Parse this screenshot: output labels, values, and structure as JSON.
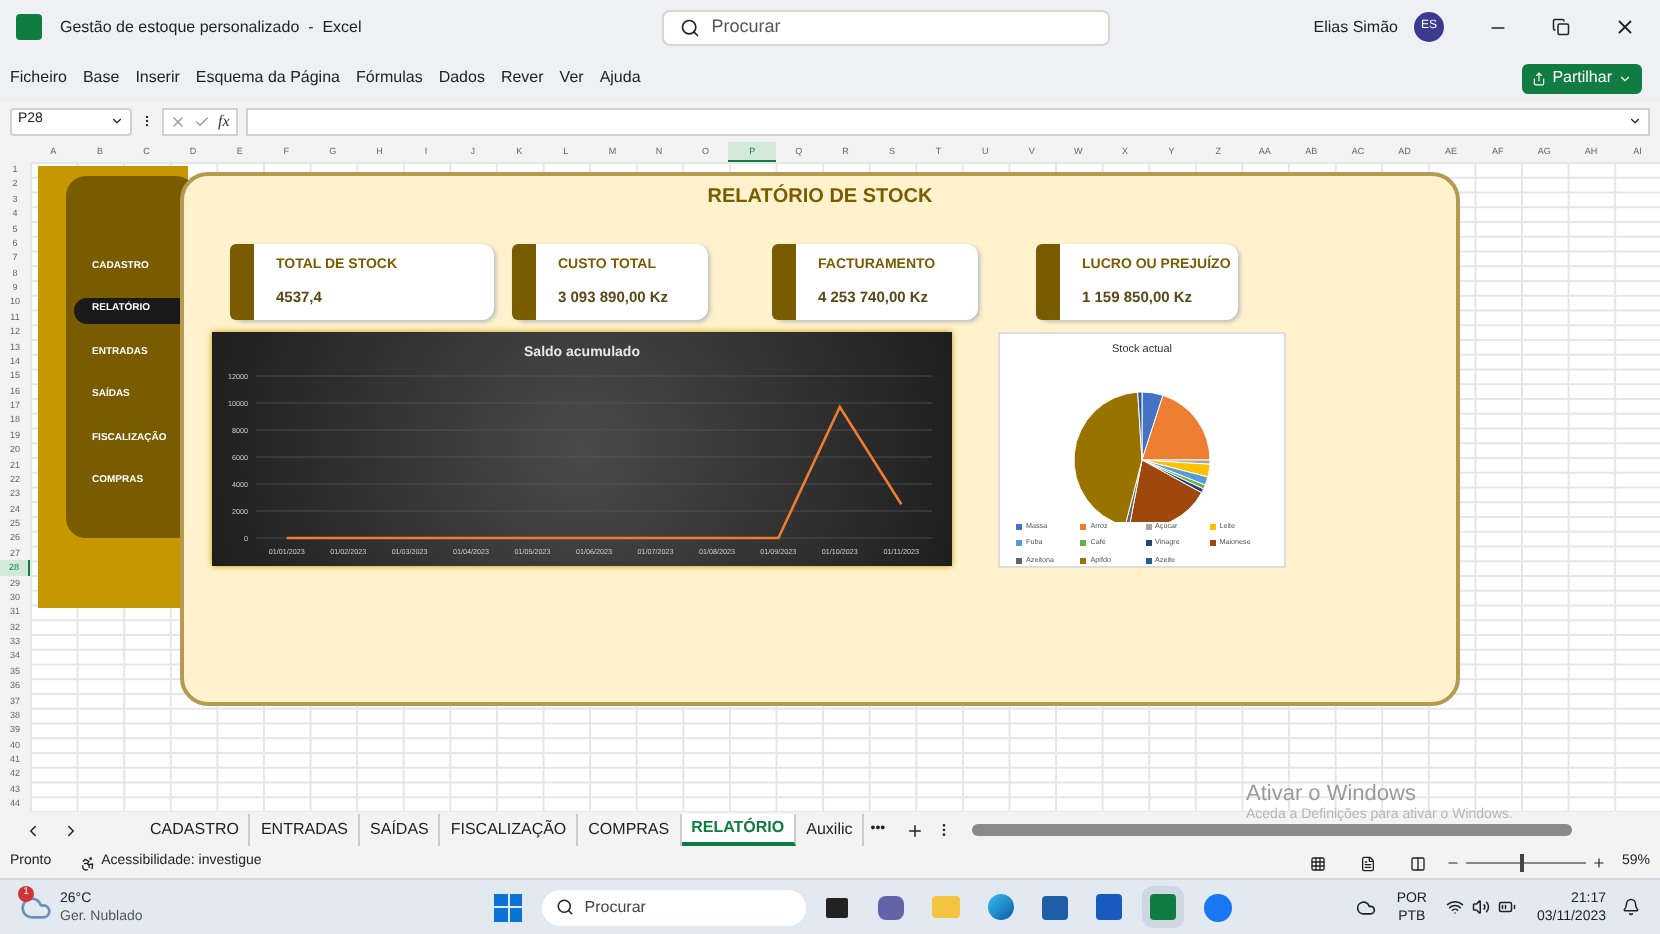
{
  "window": {
    "title": "Gestão de estoque personalizado  -  Excel",
    "search_placeholder": "Procurar",
    "user_name": "Elias Simão",
    "user_initials": "ES"
  },
  "ribbon_tabs": [
    "Ficheiro",
    "Base",
    "Inserir",
    "Esquema da Página",
    "Fórmulas",
    "Dados",
    "Rever",
    "Ver",
    "Ajuda"
  ],
  "share_button": "Partilhar",
  "formula_bar": {
    "name_box": "P28",
    "function_label": "fx"
  },
  "columns": [
    {
      "label": "A",
      "selected": false
    },
    {
      "label": "B",
      "selected": false
    },
    {
      "label": "C",
      "selected": false
    },
    {
      "label": "D",
      "selected": false
    },
    {
      "label": "E",
      "selected": false
    },
    {
      "label": "F",
      "selected": false
    },
    {
      "label": "G",
      "selected": false
    },
    {
      "label": "H",
      "selected": false
    },
    {
      "label": "I",
      "selected": false
    },
    {
      "label": "J",
      "selected": false
    },
    {
      "label": "K",
      "selected": false
    },
    {
      "label": "L",
      "selected": false
    },
    {
      "label": "M",
      "selected": false
    },
    {
      "label": "N",
      "selected": false
    },
    {
      "label": "O",
      "selected": false
    },
    {
      "label": "P",
      "selected": true
    },
    {
      "label": "Q",
      "selected": false
    },
    {
      "label": "R",
      "selected": false
    },
    {
      "label": "S",
      "selected": false
    },
    {
      "label": "T",
      "selected": false
    },
    {
      "label": "U",
      "selected": false
    },
    {
      "label": "V",
      "selected": false
    },
    {
      "label": "W",
      "selected": false
    },
    {
      "label": "X",
      "selected": false
    },
    {
      "label": "Y",
      "selected": false
    },
    {
      "label": "Z",
      "selected": false
    },
    {
      "label": "AA",
      "selected": false
    },
    {
      "label": "AB",
      "selected": false
    },
    {
      "label": "AC",
      "selected": false
    },
    {
      "label": "AD",
      "selected": false
    },
    {
      "label": "AE",
      "selected": false
    },
    {
      "label": "AF",
      "selected": false
    },
    {
      "label": "AG",
      "selected": false
    },
    {
      "label": "AH",
      "selected": false
    },
    {
      "label": "AI",
      "selected": false
    }
  ],
  "rows": [
    {
      "label": "1",
      "selected": false
    },
    {
      "label": "2",
      "selected": false
    },
    {
      "label": "3",
      "selected": false
    },
    {
      "label": "4",
      "selected": false
    },
    {
      "label": "5",
      "selected": false
    },
    {
      "label": "6",
      "selected": false
    },
    {
      "label": "7",
      "selected": false
    },
    {
      "label": "8",
      "selected": false
    },
    {
      "label": "9",
      "selected": false
    },
    {
      "label": "10",
      "selected": false
    },
    {
      "label": "11",
      "selected": false
    },
    {
      "label": "12",
      "selected": false
    },
    {
      "label": "13",
      "selected": false
    },
    {
      "label": "14",
      "selected": false
    },
    {
      "label": "15",
      "selected": false
    },
    {
      "label": "16",
      "selected": false
    },
    {
      "label": "17",
      "selected": false
    },
    {
      "label": "18",
      "selected": false
    },
    {
      "label": "19",
      "selected": false
    },
    {
      "label": "20",
      "selected": false
    },
    {
      "label": "21",
      "selected": false
    },
    {
      "label": "22",
      "selected": false
    },
    {
      "label": "23",
      "selected": false
    },
    {
      "label": "24",
      "selected": false
    },
    {
      "label": "25",
      "selected": false
    },
    {
      "label": "26",
      "selected": false
    },
    {
      "label": "27",
      "selected": false
    },
    {
      "label": "28",
      "selected": true
    },
    {
      "label": "29",
      "selected": false
    },
    {
      "label": "30",
      "selected": false
    },
    {
      "label": "31",
      "selected": false
    },
    {
      "label": "32",
      "selected": false
    },
    {
      "label": "33",
      "selected": false
    },
    {
      "label": "34",
      "selected": false
    },
    {
      "label": "35",
      "selected": false
    },
    {
      "label": "36",
      "selected": false
    },
    {
      "label": "37",
      "selected": false
    },
    {
      "label": "38",
      "selected": false
    },
    {
      "label": "39",
      "selected": false
    },
    {
      "label": "40",
      "selected": false
    },
    {
      "label": "41",
      "selected": false
    },
    {
      "label": "42",
      "selected": false
    },
    {
      "label": "43",
      "selected": false
    },
    {
      "label": "44",
      "selected": false
    }
  ],
  "dashboard": {
    "title": "RELATÓRIO DE STOCK",
    "nav_items": [
      {
        "label": "CADASTRO",
        "selected": false
      },
      {
        "label": "RELATÓRIO",
        "selected": true
      },
      {
        "label": "ENTRADAS",
        "selected": false
      },
      {
        "label": "SAÍDAS",
        "selected": false
      },
      {
        "label": "FISCALIZAÇÃO",
        "selected": false
      },
      {
        "label": "COMPRAS",
        "selected": false
      }
    ],
    "cards": [
      {
        "label": "TOTAL DE STOCK",
        "value": "4537,4"
      },
      {
        "label": "CUSTO TOTAL",
        "value": "3 093 890,00 Kz"
      },
      {
        "label": "FACTURAMENTO",
        "value": "4 253 740,00 Kz"
      },
      {
        "label": "LUCRO OU PREJUÍZO",
        "value": "1 159 850,00 Kz"
      }
    ],
    "line_chart": {
      "chart_data": {
        "type": "line",
        "title": "Saldo acumulado",
        "categories": [
          "01/01/2023",
          "01/02/2023",
          "01/03/2023",
          "01/04/2023",
          "01/05/2023",
          "01/06/2023",
          "01/07/2023",
          "01/08/2023",
          "01/09/2023",
          "01/10/2023",
          "01/11/2023"
        ],
        "series": [
          {
            "color": "#ed7d31",
            "values": [
              0,
              0,
              0,
              0,
              0,
              0,
              0,
              0,
              0,
              9700,
              2500
            ]
          }
        ],
        "grid": true,
        "ylim": [
          0,
          12000
        ],
        "yticks": [
          0,
          2000,
          4000,
          6000,
          8000,
          10000,
          12000
        ]
      }
    },
    "pie_chart": {
      "title": "Stock actual",
      "legend": [
        {
          "name": "Massa",
          "color": "#4472c4"
        },
        {
          "name": "Arroz",
          "color": "#ed7d31"
        },
        {
          "name": "Açúcar",
          "color": "#a5a5a5"
        },
        {
          "name": "Leite",
          "color": "#ffc000"
        },
        {
          "name": "Fuba",
          "color": "#5b9bd5"
        },
        {
          "name": "Café",
          "color": "#70ad47"
        },
        {
          "name": "Vinagre",
          "color": "#264478"
        },
        {
          "name": "Maionese",
          "color": "#9e480e"
        },
        {
          "name": "Azeitona",
          "color": "#636363"
        },
        {
          "name": "Apifdo",
          "color": "#997300"
        },
        {
          "name": "Azeite",
          "color": "#255e91"
        }
      ]
    }
  },
  "sheet_tabs": [
    {
      "label": "CADASTRO",
      "selected": false
    },
    {
      "label": "ENTRADAS",
      "selected": false
    },
    {
      "label": "SAÍDAS",
      "selected": false
    },
    {
      "label": "FISCALIZAÇÃO",
      "selected": false
    },
    {
      "label": "COMPRAS",
      "selected": false
    },
    {
      "label": "RELATÓRIO",
      "selected": true
    },
    {
      "label": "Auxilic",
      "selected": false
    }
  ],
  "sheet_more": "•••",
  "activation_notice": {
    "title": "Ativar o Windows",
    "text": "Aceda a Definições para ativar o Windows."
  },
  "status_bar": {
    "status": "Pronto",
    "accessibility": "Acessibilidade: investigue",
    "zoom": "59%",
    "zoom_slider": {
      "level": 0.45
    }
  },
  "taskbar": {
    "weather_temp": "26°C",
    "weather_text": "Ger. Nublado",
    "weather_badge": "1",
    "search_placeholder": "Procurar",
    "language": "POR",
    "keyboard": "PTB",
    "time": "21:17",
    "date": "03/11/2023"
  }
}
